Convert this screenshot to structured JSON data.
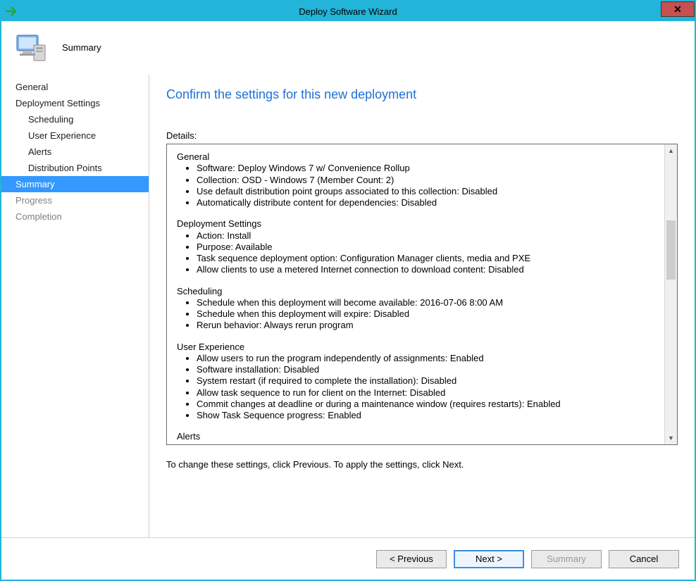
{
  "window": {
    "title": "Deploy Software Wizard"
  },
  "header": {
    "title": "Summary"
  },
  "sidebar": {
    "items": [
      {
        "label": "General",
        "sub": false,
        "state": "normal"
      },
      {
        "label": "Deployment Settings",
        "sub": false,
        "state": "normal"
      },
      {
        "label": "Scheduling",
        "sub": true,
        "state": "normal"
      },
      {
        "label": "User Experience",
        "sub": true,
        "state": "normal"
      },
      {
        "label": "Alerts",
        "sub": true,
        "state": "normal"
      },
      {
        "label": "Distribution Points",
        "sub": true,
        "state": "normal"
      },
      {
        "label": "Summary",
        "sub": false,
        "state": "selected"
      },
      {
        "label": "Progress",
        "sub": false,
        "state": "disabled"
      },
      {
        "label": "Completion",
        "sub": false,
        "state": "disabled"
      }
    ]
  },
  "main": {
    "heading": "Confirm the settings for this new deployment",
    "details_label": "Details:",
    "sections": [
      {
        "title": "General",
        "items": [
          "Software: Deploy Windows 7 w/ Convenience Rollup",
          "Collection: OSD - Windows 7 (Member Count: 2)",
          "Use default distribution point groups associated to this collection: Disabled",
          "Automatically distribute content for dependencies: Disabled"
        ]
      },
      {
        "title": "Deployment Settings",
        "items": [
          "Action: Install",
          "Purpose: Available",
          "Task sequence deployment option: Configuration Manager clients, media and PXE",
          "Allow clients to use a metered Internet connection to download content: Disabled"
        ]
      },
      {
        "title": "Scheduling",
        "items": [
          "Schedule when this deployment will become available: 2016-07-06 8:00 AM",
          "Schedule when this deployment will expire: Disabled",
          "Rerun behavior: Always rerun program"
        ]
      },
      {
        "title": "User Experience",
        "items": [
          "Allow users to run the program independently of assignments: Enabled",
          "Software installation: Disabled",
          "System restart (if required to complete the installation): Disabled",
          "Allow task sequence to run for client on the Internet: Disabled",
          "Commit changes at deadline or during a maintenance window (requires restarts): Enabled",
          "Show Task Sequence progress: Enabled"
        ]
      },
      {
        "title": "Alerts",
        "items": []
      }
    ],
    "hint": "To change these settings, click Previous. To apply the settings, click Next."
  },
  "footer": {
    "previous": "< Previous",
    "next": "Next >",
    "summary": "Summary",
    "cancel": "Cancel"
  }
}
